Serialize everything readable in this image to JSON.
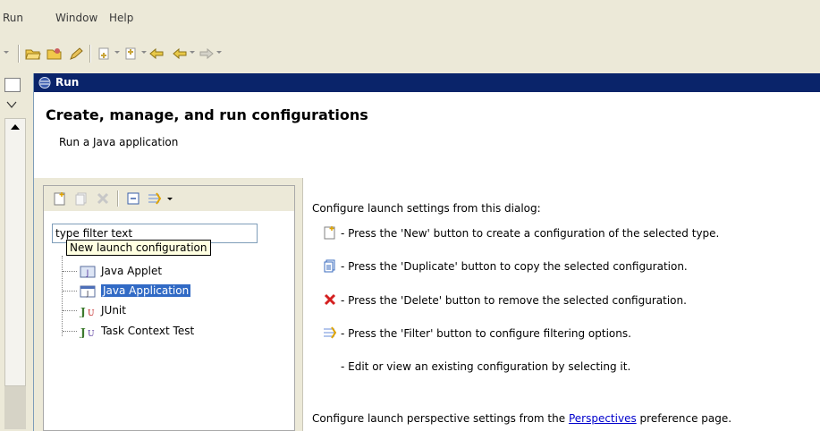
{
  "menubar": {
    "items": [
      {
        "label": "Run"
      },
      {
        "label": "Window"
      },
      {
        "label": "Help"
      }
    ]
  },
  "dialog": {
    "title": "Run",
    "header_title": "Create, manage, and run configurations",
    "header_subtitle": "Run a Java application",
    "filter": {
      "value": "type filter text",
      "tooltip": "New launch configuration"
    },
    "tree": [
      {
        "label": "Java Applet",
        "icon": "java-applet-icon",
        "selected": false
      },
      {
        "label": "Java Application",
        "icon": "java-application-icon",
        "selected": true
      },
      {
        "label": "JUnit",
        "icon": "junit-icon",
        "selected": false
      },
      {
        "label": "Task Context Test",
        "icon": "task-context-test-icon",
        "selected": false
      }
    ],
    "info": {
      "intro": "Configure launch settings from this dialog:",
      "lines": [
        {
          "icon": "new-icon",
          "text": "- Press the 'New' button to create a configuration of the selected type."
        },
        {
          "icon": "duplicate-icon",
          "text": "- Press the 'Duplicate' button to copy the selected configuration."
        },
        {
          "icon": "delete-icon",
          "text": "- Press the 'Delete' button to remove the selected configuration."
        },
        {
          "icon": "filter-icon",
          "text": "- Press the 'Filter' button to configure filtering options."
        },
        {
          "icon": "",
          "text": "- Edit or view an existing configuration by selecting it."
        }
      ],
      "footer_prefix": "Configure launch perspective settings from the",
      "footer_link": "Perspectives",
      "footer_suffix": "preference page."
    }
  },
  "colors": {
    "titlebar": "#0a246a",
    "selection": "#316ac5",
    "tooltip_bg": "#ffffe1",
    "link": "#0000cc"
  }
}
